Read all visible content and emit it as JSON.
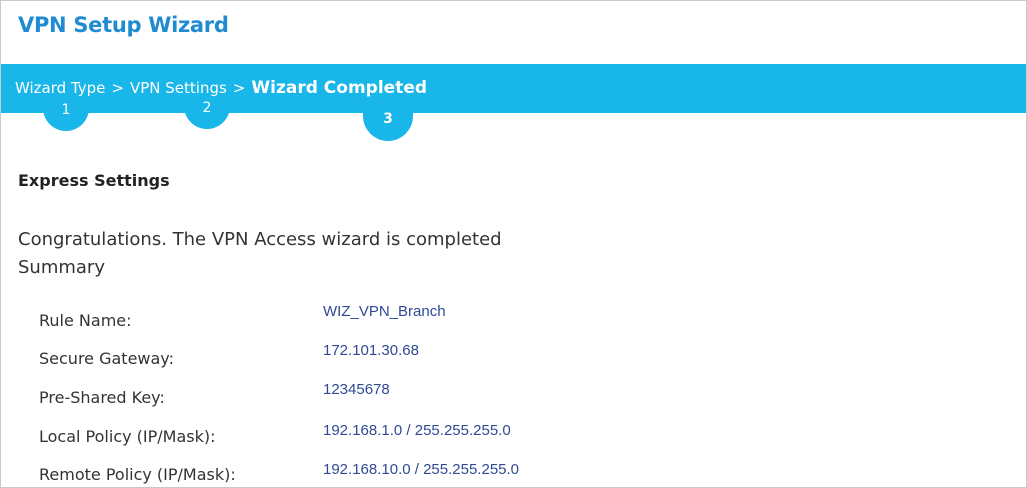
{
  "window": {
    "title": "VPN Setup Wizard"
  },
  "wizard_steps": [
    {
      "label": "Wizard Type",
      "number": "1"
    },
    {
      "label": "VPN Settings",
      "number": "2"
    },
    {
      "label": "Wizard Completed",
      "number": "3"
    }
  ],
  "breadcrumb_separator": ">",
  "section": {
    "title": "Express Settings"
  },
  "message": "Congratulations. The VPN Access wizard is completed",
  "summary": {
    "label": "Summary",
    "rows": [
      {
        "label": "Rule Name:",
        "value": "WIZ_VPN_Branch"
      },
      {
        "label": "Secure Gateway:",
        "value": "172.101.30.68"
      },
      {
        "label": "Pre-Shared Key:",
        "value": "12345678"
      },
      {
        "label": "Local Policy (IP/Mask):",
        "value": "192.168.1.0 / 255.255.255.0"
      },
      {
        "label": "Remote Policy (IP/Mask):",
        "value": "192.168.10.0 / 255.255.255.0"
      }
    ]
  },
  "colors": {
    "accent": "#19b6ea",
    "title": "#1e8bd3",
    "value_text": "#2f4a95"
  }
}
